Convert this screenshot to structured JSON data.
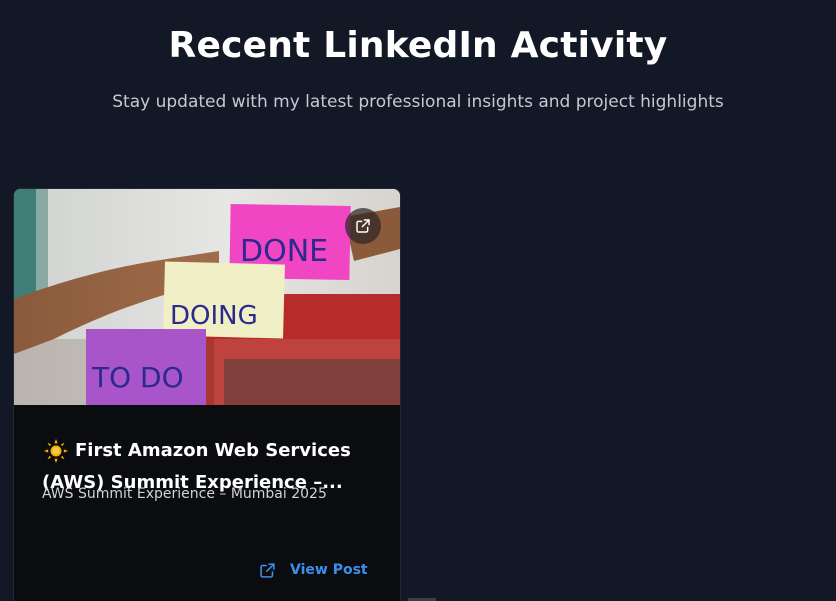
{
  "section": {
    "title": "Recent LinkedIn Activity",
    "subtitle": "Stay updated with my latest professional insights and project highlights"
  },
  "posts": [
    {
      "title_line1": "First Amazon Web Services",
      "title_line2": "(AWS) Summit Experience –...",
      "subtitle": "AWS Summit Experience – Mumbai 2025",
      "view_label": "View Post",
      "emoji_icon": "sun-icon",
      "image": {
        "description_icon": "sticky-notes-photo",
        "notes": [
          "Done",
          "Doing",
          "To Do"
        ]
      }
    }
  ],
  "icons": {
    "external": "external-link-icon"
  },
  "colors": {
    "background": "#121826",
    "card": "#0b0c0f",
    "accent": "#3b8ff0",
    "heading": "#ffffff",
    "muted": "#c3c9d4"
  }
}
